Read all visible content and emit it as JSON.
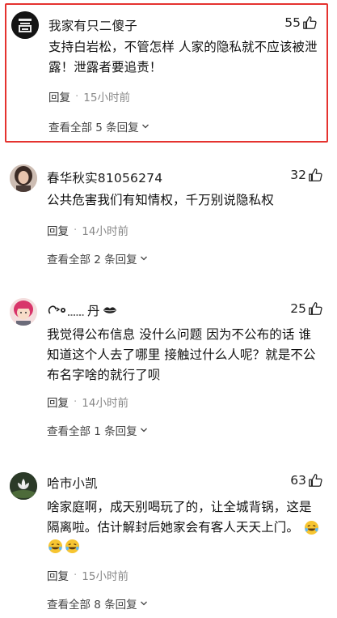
{
  "comments": [
    {
      "username": "我家有只二傻子",
      "likes": "55",
      "lines": [
        "支持白岩松，不管怎样 人家的隐私就不应该被泄",
        "露！泄露者要追责！"
      ],
      "reply_label": "回复",
      "time": "15小时前",
      "more_replies": "查看全部 5 条回复",
      "highlighted": true,
      "avatar": "logo-avatar"
    },
    {
      "username": "春华秋实81056274",
      "likes": "32",
      "lines": [
        "公共危害我们有知情权，千万别说隐私权"
      ],
      "reply_label": "回复",
      "time": "14小时前",
      "more_replies": "查看全部 2 条回复",
      "avatar": "woman-photo-avatar"
    },
    {
      "username": "丹",
      "likes": "25",
      "lines": [
        "我觉得公布信息 没什么问题 因为不公布的话 谁",
        "知道这个人去了哪里 接触过什么人呢？就是不公",
        "布名字啥的就行了呗"
      ],
      "reply_label": "回复",
      "time": "14小时前",
      "more_replies": "查看全部 1 条回复",
      "avatar": "girl-cartoon-avatar"
    },
    {
      "username": "哈市小凯",
      "likes": "63",
      "lines": [
        "啥家庭啊，成天别喝玩了的，让全城背锅，这是",
        "隔离啦。估计解封后她家会有客人天天上门。"
      ],
      "reply_label": "回复",
      "time": "15小时前",
      "more_replies": "查看全部 8 条回复",
      "emoji": "crying-laughing-emoji",
      "avatar": "lotus-avatar"
    }
  ],
  "colors": {
    "highlight_border": "#e5332f",
    "meta_gray": "#888888"
  }
}
